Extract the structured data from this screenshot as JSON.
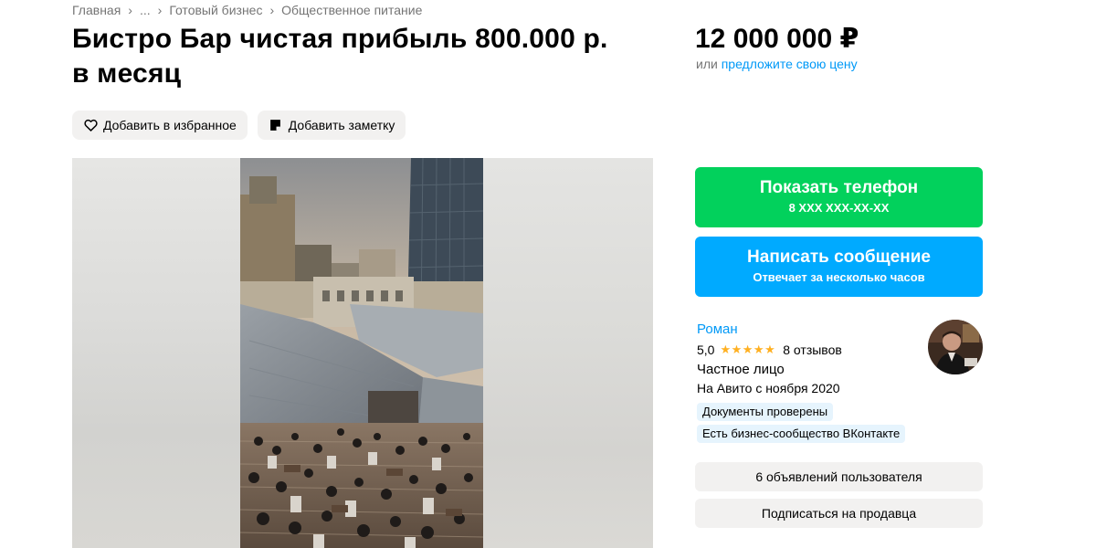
{
  "breadcrumbs": [
    "Главная",
    "...",
    "Готовый бизнес",
    "Общественное питание"
  ],
  "title_line1": "Бистро Бар чистая прибыль 800.000 р.",
  "title_line2": "в месяц",
  "price": {
    "value": "12 000 000 ₽",
    "or": "или",
    "offer_link": "предложите свою цену"
  },
  "actions": {
    "favorite_label": "Добавить в избранное",
    "note_label": "Добавить заметку",
    "favorite_icon": "heart-icon",
    "note_icon": "note-icon"
  },
  "contact": {
    "phone_label": "Показать телефон",
    "phone_masked": "8 XXX XXX-XX-XX",
    "message_label": "Написать сообщение",
    "message_sub": "Отвечает за несколько часов"
  },
  "seller": {
    "name": "Роман",
    "rating": "5,0",
    "stars": "★★★★★",
    "rating_stars": 5,
    "reviews": "8 отзывов",
    "type": "Частное лицо",
    "since": "На Авито с ноября 2020",
    "badges": [
      "Документы проверены",
      "Есть бизнес-сообщество ВКонтакте"
    ]
  },
  "buttons": {
    "ads_count": "6 объявлений пользователя",
    "subscribe": "Подписаться на продавца"
  },
  "colors": {
    "green": "#02d15c",
    "blue": "#00aaff",
    "link": "#0099f7",
    "star": "#ffb021",
    "grey_button": "#f2f1f0"
  }
}
